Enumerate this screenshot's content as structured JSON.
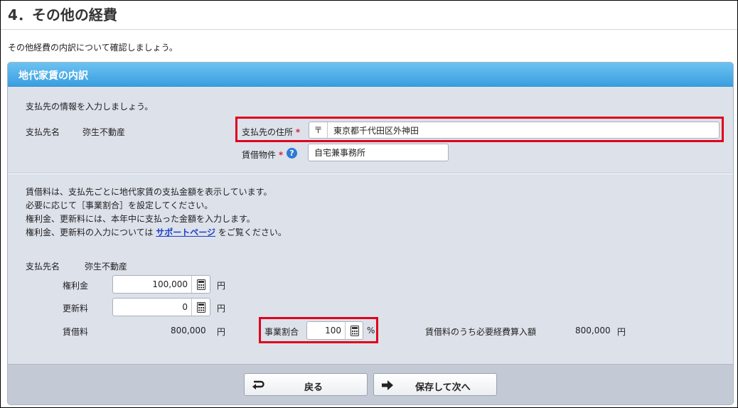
{
  "page": {
    "title": "4．その他の経費",
    "intro": "その他経費の内訳について確認しましょう。"
  },
  "panel": {
    "title": "地代家賃の内訳",
    "payee_instruction": "支払先の情報を入力しましょう。",
    "payee_name_label": "支払先名",
    "payee_name_value": "弥生不動産",
    "address_label": "支払先の住所",
    "required_mark": "*",
    "zip_mark": "〒",
    "address_value": "東京都千代田区外神田",
    "property_label": "賃借物件",
    "help_glyph": "?",
    "property_value": "自宅兼事務所",
    "notes": {
      "line1": "賃借料は、支払先ごとに地代家賃の支払金額を表示しています。",
      "line2": "必要に応じて［事業割合］を設定してください。",
      "line3": "権利金、更新料には、本年中に支払った金額を入力します。",
      "line4_prefix": "権利金、更新料の入力については",
      "line4_link": "サポートページ",
      "line4_suffix": "をご覧ください。"
    },
    "detail": {
      "payee_name_label": "支払先名",
      "payee_name_value": "弥生不動産",
      "key_money_label": "権利金",
      "key_money_value": "100,000",
      "renewal_fee_label": "更新料",
      "renewal_fee_value": "0",
      "yen_unit": "円",
      "rent_label": "賃借料",
      "rent_value": "800,000",
      "business_ratio_label": "事業割合",
      "business_ratio_value": "100",
      "percent_unit": "%",
      "expense_label": "賃借料のうち必要経費算入額",
      "expense_value": "800,000"
    }
  },
  "buttons": {
    "back_label": "戻る",
    "save_next_label": "保存して次へ"
  },
  "colors": {
    "panel_header": "#3a9fe0",
    "panel_background": "#dde1ea",
    "highlight": "#e0001c",
    "link": "#1b3fc7",
    "required": "#d9213b"
  },
  "icons": {
    "calculator": "calculator-icon",
    "help": "help-icon",
    "back": "return-arrow-icon",
    "next": "right-arrow-icon"
  }
}
